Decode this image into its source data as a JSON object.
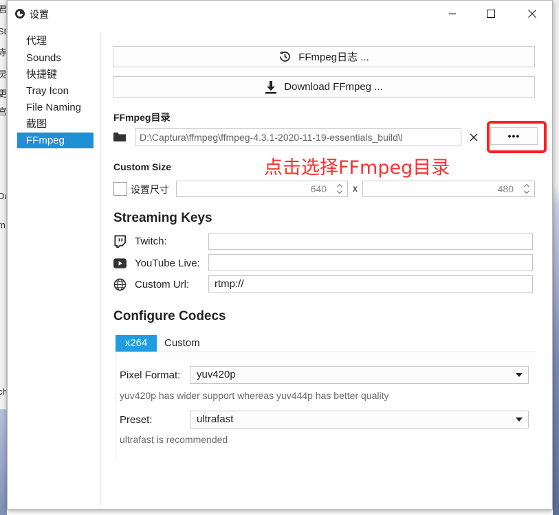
{
  "window": {
    "title": "设置"
  },
  "background": {
    "left_text": [
      "君",
      "St",
      "寺",
      "灵",
      "更",
      "宫",
      "Da",
      "m",
      "ch"
    ]
  },
  "sidebar": {
    "items": [
      {
        "label": "代理"
      },
      {
        "label": "Sounds"
      },
      {
        "label": "快捷键"
      },
      {
        "label": "Tray Icon"
      },
      {
        "label": "File Naming"
      },
      {
        "label": "截图"
      },
      {
        "label": "FFmpeg",
        "active": true
      }
    ]
  },
  "ffmpeg": {
    "log_button": "FFmpeg日志 ...",
    "download_button": "Download FFmpeg ...",
    "folder_label": "FFmpeg目录",
    "folder_path": "D:\\Captura\\ffmpeg\\ffmpeg-4.3.1-2020-11-19-essentials_build\\l",
    "clear_button": "✕",
    "browse_button": "•••",
    "annotation": "点击选择FFmpeg目录"
  },
  "custom_size": {
    "label": "Custom Size",
    "checkbox_label": "设置尺寸",
    "checked": false,
    "width": "640",
    "separator": "x",
    "height": "480"
  },
  "streaming": {
    "heading": "Streaming Keys",
    "rows": [
      {
        "icon": "twitch-icon",
        "label": "Twitch:",
        "value": ""
      },
      {
        "icon": "youtube-icon",
        "label": "YouTube Live:",
        "value": ""
      },
      {
        "icon": "globe-icon",
        "label": "Custom Url:",
        "value": "rtmp://"
      }
    ]
  },
  "codecs": {
    "heading": "Configure Codecs",
    "tabs": [
      {
        "label": "x264",
        "active": true
      },
      {
        "label": "Custom",
        "active": false
      }
    ],
    "pixel_format_label": "Pixel Format:",
    "pixel_format_value": "yuv420p",
    "pixel_format_hint": "yuv420p has wider support whereas yuv444p has better quality",
    "preset_label": "Preset:",
    "preset_value": "ultrafast",
    "preset_hint": "ultrafast is recommended"
  },
  "colors": {
    "accent": "#1f8fd6",
    "annotation_red": "#ff2f2f",
    "tab_active": "#1f9de0"
  }
}
